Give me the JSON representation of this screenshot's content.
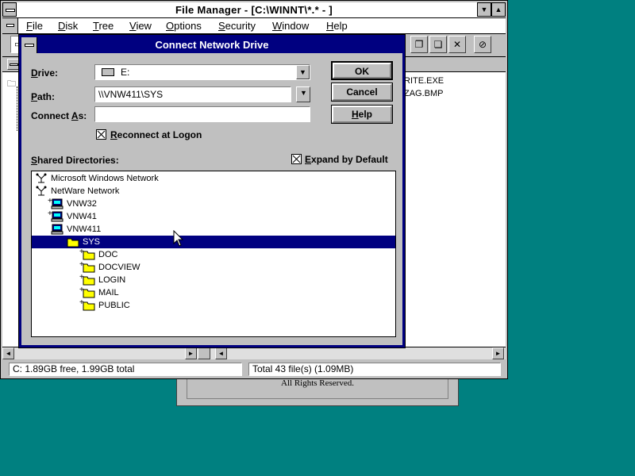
{
  "background_window": {
    "text": "All Rights Reserved."
  },
  "file_manager": {
    "title": "File Manager - [C:\\WINNT\\*.* - ]",
    "menu": [
      "File",
      "Disk",
      "Tree",
      "View",
      "Options",
      "Security",
      "Window",
      "Help"
    ],
    "files": [
      "RITE.EXE",
      "ZAG.BMP"
    ],
    "status_left": "C: 1.89GB free,  1.99GB total",
    "status_right": "Total 43 file(s) (1.09MB)"
  },
  "dialog": {
    "title": "Connect Network Drive",
    "drive_label": "Drive:",
    "drive_value": "E:",
    "path_label": "Path:",
    "path_value": "\\\\VNW411\\SYS",
    "connect_as_label": "Connect As:",
    "connect_as_value": "",
    "reconnect_label": "Reconnect at Logon",
    "reconnect_checked": true,
    "shared_dirs_label": "Shared Directories:",
    "expand_label": "Expand by Default",
    "expand_checked": true,
    "ok_label": "OK",
    "cancel_label": "Cancel",
    "help_label": "Help",
    "tree": [
      {
        "label": "Microsoft Windows Network",
        "icon": "network-icon",
        "level": 0,
        "plus": false,
        "selected": false
      },
      {
        "label": "NetWare Network",
        "icon": "network-icon",
        "level": 0,
        "plus": false,
        "selected": false
      },
      {
        "label": "VNW32",
        "icon": "server-icon",
        "level": 1,
        "plus": true,
        "selected": false
      },
      {
        "label": "VNW41",
        "icon": "server-icon",
        "level": 1,
        "plus": true,
        "selected": false
      },
      {
        "label": "VNW411",
        "icon": "server-icon",
        "level": 1,
        "plus": false,
        "selected": false
      },
      {
        "label": "SYS",
        "icon": "folder-icon",
        "level": 2,
        "plus": false,
        "selected": true
      },
      {
        "label": "DOC",
        "icon": "folder-icon",
        "level": 3,
        "plus": true,
        "selected": false
      },
      {
        "label": "DOCVIEW",
        "icon": "folder-icon",
        "level": 3,
        "plus": true,
        "selected": false
      },
      {
        "label": "LOGIN",
        "icon": "folder-icon",
        "level": 3,
        "plus": true,
        "selected": false
      },
      {
        "label": "MAIL",
        "icon": "folder-icon",
        "level": 3,
        "plus": true,
        "selected": false
      },
      {
        "label": "PUBLIC",
        "icon": "folder-icon",
        "level": 3,
        "plus": true,
        "selected": false
      }
    ]
  },
  "colors": {
    "desktop": "#008080",
    "title_active": "#000080",
    "face": "#c0c0c0",
    "selection": "#000080"
  }
}
